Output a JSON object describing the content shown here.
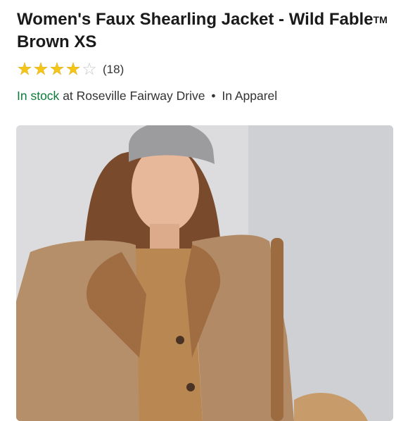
{
  "product": {
    "title_main": "Women's Faux Shearling Jacket - Wild Fable",
    "trademark": "TM",
    "title_variant": "Brown XS",
    "rating": {
      "value": 4,
      "max": 5,
      "count_label": "(18)"
    },
    "availability": {
      "status": "In stock",
      "store_text": "at Roseville Fairway Drive",
      "separator": "•",
      "department": "In Apparel"
    }
  },
  "colors": {
    "in_stock": "#0b7a3a",
    "star_filled": "#f5c518",
    "star_empty": "#c8c8c8",
    "jacket": "#b18a64",
    "sherpa": "#a27046",
    "beanie": "#9b9b9b",
    "background": "#d9d9dc"
  },
  "icons": {
    "star": "star-icon"
  }
}
